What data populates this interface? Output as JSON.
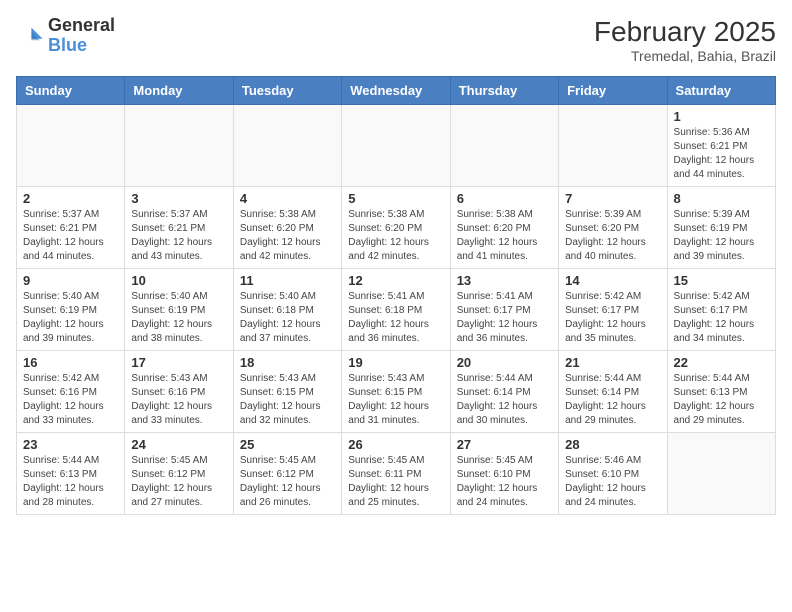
{
  "header": {
    "logo_general": "General",
    "logo_blue": "Blue",
    "month_year": "February 2025",
    "location": "Tremedal, Bahia, Brazil"
  },
  "days_of_week": [
    "Sunday",
    "Monday",
    "Tuesday",
    "Wednesday",
    "Thursday",
    "Friday",
    "Saturday"
  ],
  "weeks": [
    [
      {
        "day": "",
        "info": ""
      },
      {
        "day": "",
        "info": ""
      },
      {
        "day": "",
        "info": ""
      },
      {
        "day": "",
        "info": ""
      },
      {
        "day": "",
        "info": ""
      },
      {
        "day": "",
        "info": ""
      },
      {
        "day": "1",
        "info": "Sunrise: 5:36 AM\nSunset: 6:21 PM\nDaylight: 12 hours and 44 minutes."
      }
    ],
    [
      {
        "day": "2",
        "info": "Sunrise: 5:37 AM\nSunset: 6:21 PM\nDaylight: 12 hours and 44 minutes."
      },
      {
        "day": "3",
        "info": "Sunrise: 5:37 AM\nSunset: 6:21 PM\nDaylight: 12 hours and 43 minutes."
      },
      {
        "day": "4",
        "info": "Sunrise: 5:38 AM\nSunset: 6:20 PM\nDaylight: 12 hours and 42 minutes."
      },
      {
        "day": "5",
        "info": "Sunrise: 5:38 AM\nSunset: 6:20 PM\nDaylight: 12 hours and 42 minutes."
      },
      {
        "day": "6",
        "info": "Sunrise: 5:38 AM\nSunset: 6:20 PM\nDaylight: 12 hours and 41 minutes."
      },
      {
        "day": "7",
        "info": "Sunrise: 5:39 AM\nSunset: 6:20 PM\nDaylight: 12 hours and 40 minutes."
      },
      {
        "day": "8",
        "info": "Sunrise: 5:39 AM\nSunset: 6:19 PM\nDaylight: 12 hours and 39 minutes."
      }
    ],
    [
      {
        "day": "9",
        "info": "Sunrise: 5:40 AM\nSunset: 6:19 PM\nDaylight: 12 hours and 39 minutes."
      },
      {
        "day": "10",
        "info": "Sunrise: 5:40 AM\nSunset: 6:19 PM\nDaylight: 12 hours and 38 minutes."
      },
      {
        "day": "11",
        "info": "Sunrise: 5:40 AM\nSunset: 6:18 PM\nDaylight: 12 hours and 37 minutes."
      },
      {
        "day": "12",
        "info": "Sunrise: 5:41 AM\nSunset: 6:18 PM\nDaylight: 12 hours and 36 minutes."
      },
      {
        "day": "13",
        "info": "Sunrise: 5:41 AM\nSunset: 6:17 PM\nDaylight: 12 hours and 36 minutes."
      },
      {
        "day": "14",
        "info": "Sunrise: 5:42 AM\nSunset: 6:17 PM\nDaylight: 12 hours and 35 minutes."
      },
      {
        "day": "15",
        "info": "Sunrise: 5:42 AM\nSunset: 6:17 PM\nDaylight: 12 hours and 34 minutes."
      }
    ],
    [
      {
        "day": "16",
        "info": "Sunrise: 5:42 AM\nSunset: 6:16 PM\nDaylight: 12 hours and 33 minutes."
      },
      {
        "day": "17",
        "info": "Sunrise: 5:43 AM\nSunset: 6:16 PM\nDaylight: 12 hours and 33 minutes."
      },
      {
        "day": "18",
        "info": "Sunrise: 5:43 AM\nSunset: 6:15 PM\nDaylight: 12 hours and 32 minutes."
      },
      {
        "day": "19",
        "info": "Sunrise: 5:43 AM\nSunset: 6:15 PM\nDaylight: 12 hours and 31 minutes."
      },
      {
        "day": "20",
        "info": "Sunrise: 5:44 AM\nSunset: 6:14 PM\nDaylight: 12 hours and 30 minutes."
      },
      {
        "day": "21",
        "info": "Sunrise: 5:44 AM\nSunset: 6:14 PM\nDaylight: 12 hours and 29 minutes."
      },
      {
        "day": "22",
        "info": "Sunrise: 5:44 AM\nSunset: 6:13 PM\nDaylight: 12 hours and 29 minutes."
      }
    ],
    [
      {
        "day": "23",
        "info": "Sunrise: 5:44 AM\nSunset: 6:13 PM\nDaylight: 12 hours and 28 minutes."
      },
      {
        "day": "24",
        "info": "Sunrise: 5:45 AM\nSunset: 6:12 PM\nDaylight: 12 hours and 27 minutes."
      },
      {
        "day": "25",
        "info": "Sunrise: 5:45 AM\nSunset: 6:12 PM\nDaylight: 12 hours and 26 minutes."
      },
      {
        "day": "26",
        "info": "Sunrise: 5:45 AM\nSunset: 6:11 PM\nDaylight: 12 hours and 25 minutes."
      },
      {
        "day": "27",
        "info": "Sunrise: 5:45 AM\nSunset: 6:10 PM\nDaylight: 12 hours and 24 minutes."
      },
      {
        "day": "28",
        "info": "Sunrise: 5:46 AM\nSunset: 6:10 PM\nDaylight: 12 hours and 24 minutes."
      },
      {
        "day": "",
        "info": ""
      }
    ]
  ]
}
